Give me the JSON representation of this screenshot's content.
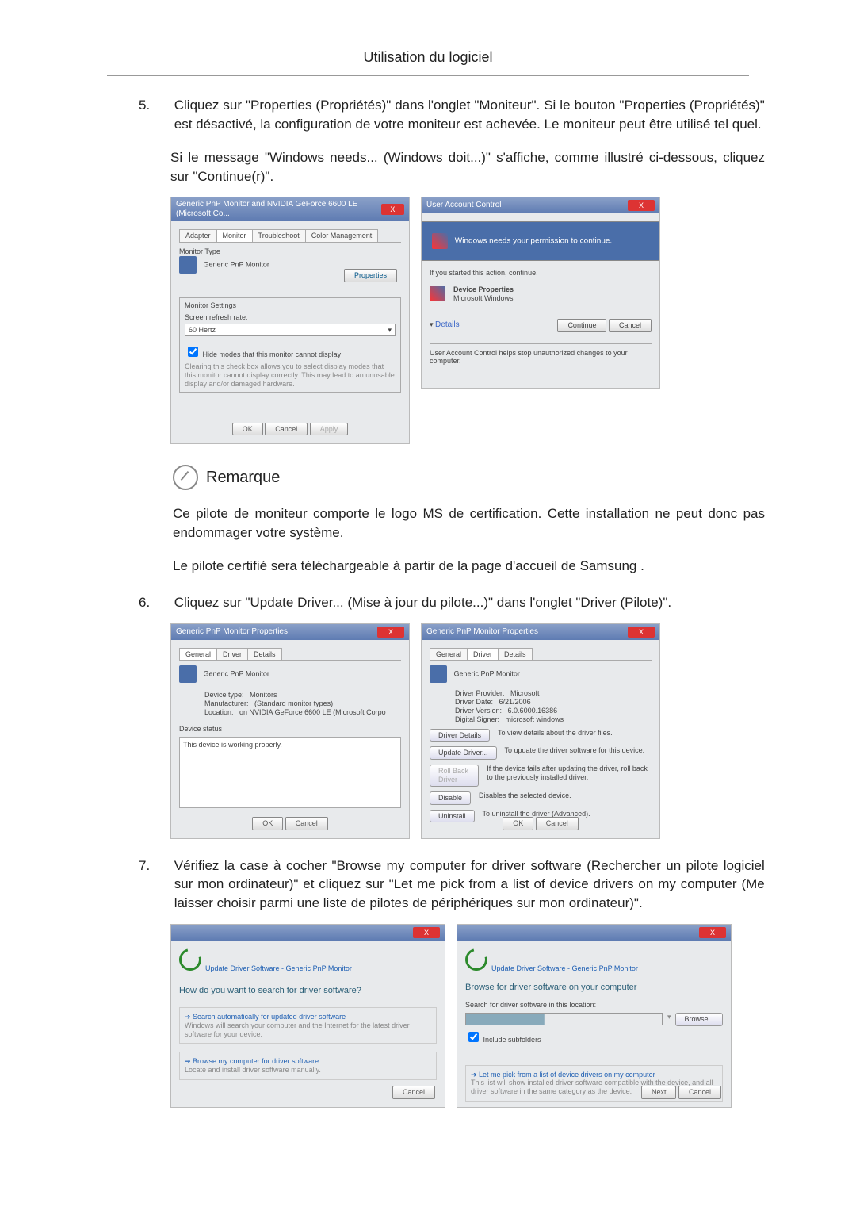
{
  "header": {
    "title": "Utilisation du logiciel"
  },
  "steps": {
    "s5": {
      "num": "5.",
      "text": "Cliquez sur \"Properties (Propriétés)\" dans l'onglet \"Moniteur\". Si le bouton \"Properties (Propriétés)\" est désactivé, la configuration de votre moniteur est achevée. Le moniteur peut être utilisé tel quel.",
      "sub": "Si le message \"Windows needs... (Windows doit...)\" s'affiche, comme illustré ci-dessous, cliquez sur \"Continue(r)\"."
    },
    "s6": {
      "num": "6.",
      "text": "Cliquez sur \"Update Driver... (Mise à jour du pilote...)\" dans l'onglet \"Driver (Pilote)\"."
    },
    "s7": {
      "num": "7.",
      "text": "Vérifiez la case à cocher \"Browse my computer for driver software (Rechercher un pilote logiciel sur mon ordinateur)\" et cliquez sur \"Let me pick from a list of device drivers on my computer (Me laisser choisir parmi une liste de pilotes de périphériques sur mon ordinateur)\"."
    }
  },
  "note": {
    "label": "Remarque",
    "p1": "Ce pilote de moniteur comporte le logo MS de certification. Cette installation ne peut donc pas endommager votre système.",
    "p2": "Le pilote certifié sera téléchargeable à partir de la page d'accueil de Samsung ."
  },
  "shotA": {
    "title": "Generic PnP Monitor and NVIDIA GeForce 6600 LE (Microsoft Co...",
    "tabs": {
      "t1": "Adapter",
      "t2": "Monitor",
      "t3": "Troubleshoot",
      "t4": "Color Management"
    },
    "mtype": "Monitor Type",
    "mname": "Generic PnP Monitor",
    "prop": "Properties",
    "ms": "Monitor Settings",
    "refresh_l": "Screen refresh rate:",
    "refresh_v": "60 Hertz",
    "hide": "Hide modes that this monitor cannot display",
    "hide2": "Clearing this check box allows you to select display modes that this monitor cannot display correctly. This may lead to an unusable display and/or damaged hardware.",
    "ok": "OK",
    "cancel": "Cancel",
    "apply": "Apply"
  },
  "shotB": {
    "title": "User Account Control",
    "bar": "Windows needs your permission to continue.",
    "started": "If you started this action, continue.",
    "dp": "Device Properties",
    "mw": "Microsoft Windows",
    "details": "Details",
    "cont": "Continue",
    "cancel": "Cancel",
    "foot": "User Account Control helps stop unauthorized changes to your computer."
  },
  "shotC1": {
    "title": "Generic PnP Monitor Properties",
    "tabs": {
      "t1": "General",
      "t2": "Driver",
      "t3": "Details"
    },
    "mname": "Generic PnP Monitor",
    "dt_l": "Device type:",
    "dt_v": "Monitors",
    "mf_l": "Manufacturer:",
    "mf_v": "(Standard monitor types)",
    "lo_l": "Location:",
    "lo_v": "on NVIDIA GeForce 6600 LE (Microsoft Corpo",
    "ds": "Device status",
    "ds_v": "This device is working properly.",
    "ok": "OK",
    "cancel": "Cancel"
  },
  "shotC2": {
    "title": "Generic PnP Monitor Properties",
    "tabs": {
      "t1": "General",
      "t2": "Driver",
      "t3": "Details"
    },
    "mname": "Generic PnP Monitor",
    "dp_l": "Driver Provider:",
    "dp_v": "Microsoft",
    "dd_l": "Driver Date:",
    "dd_v": "6/21/2006",
    "dv_l": "Driver Version:",
    "dv_v": "6.0.6000.16386",
    "ds_l": "Digital Signer:",
    "ds_v": "microsoft windows",
    "b1": "Driver Details",
    "b1t": "To view details about the driver files.",
    "b2": "Update Driver...",
    "b2t": "To update the driver software for this device.",
    "b3": "Roll Back Driver",
    "b3t": "If the device fails after updating the driver, roll back to the previously installed driver.",
    "b4": "Disable",
    "b4t": "Disables the selected device.",
    "b5": "Uninstall",
    "b5t": "To uninstall the driver (Advanced).",
    "ok": "OK",
    "cancel": "Cancel"
  },
  "shotD1": {
    "crumb": "Update Driver Software - Generic PnP Monitor",
    "q": "How do you want to search for driver software?",
    "o1": "Search automatically for updated driver software",
    "o1s": "Windows will search your computer and the Internet for the latest driver software for your device.",
    "o2": "Browse my computer for driver software",
    "o2s": "Locate and install driver software manually.",
    "cancel": "Cancel"
  },
  "shotD2": {
    "crumb": "Update Driver Software - Generic PnP Monitor",
    "h": "Browse for driver software on your computer",
    "p": "Search for driver software in this location:",
    "browse": "Browse...",
    "inc": "Include subfolders",
    "pick": "Let me pick from a list of device drivers on my computer",
    "picks": "This list will show installed driver software compatible with the device, and all driver software in the same category as the device.",
    "next": "Next",
    "cancel": "Cancel"
  }
}
